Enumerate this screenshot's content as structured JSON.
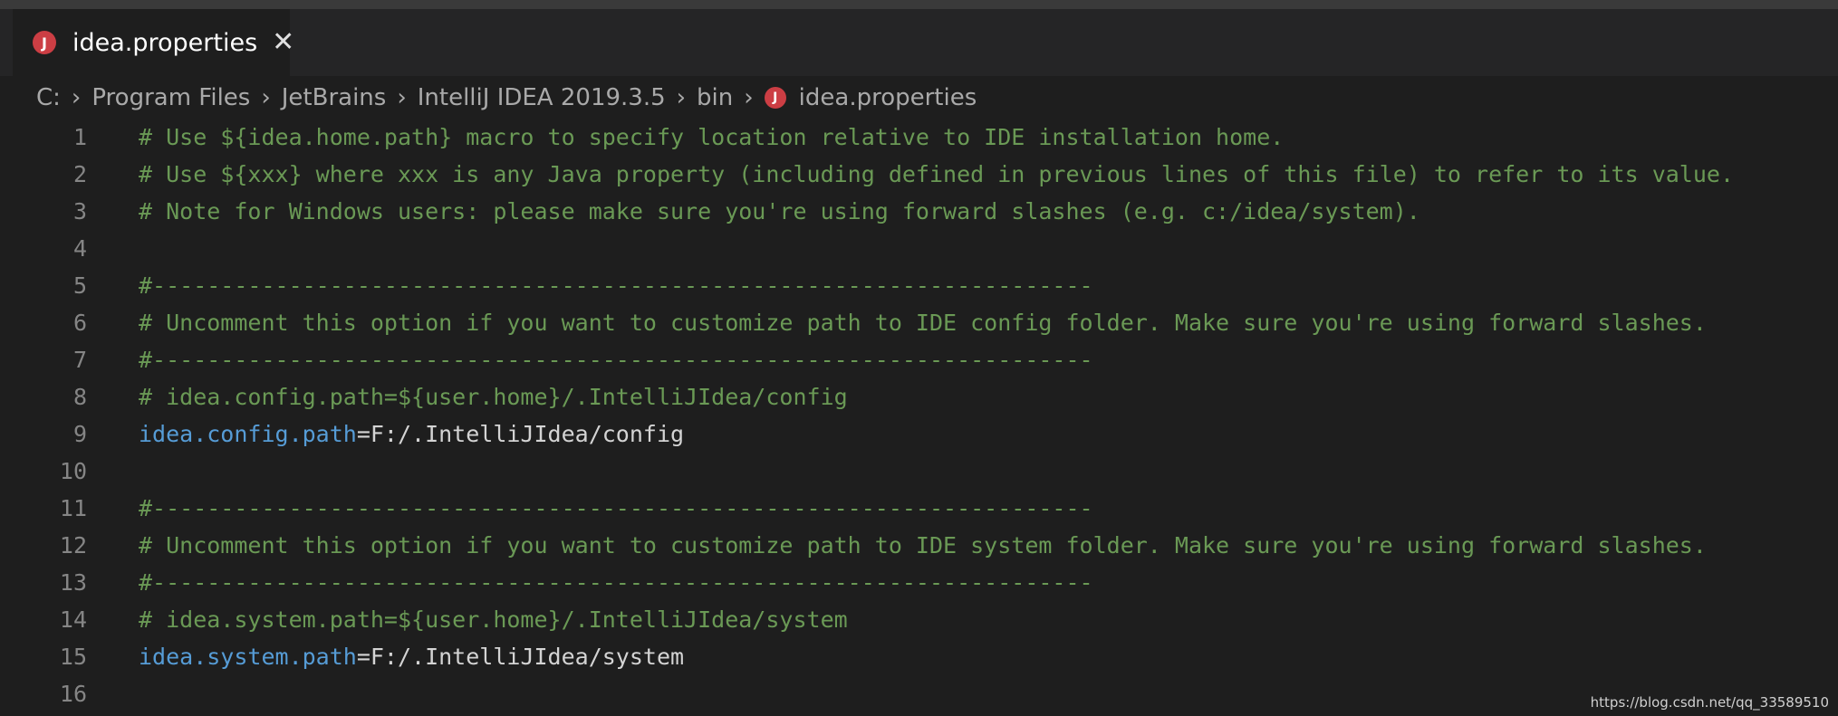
{
  "tab": {
    "icon": "J",
    "label": "idea.properties",
    "close": "✕"
  },
  "breadcrumb": {
    "items": [
      "C:",
      "Program Files",
      "JetBrains",
      "IntelliJ IDEA 2019.3.5",
      "bin"
    ],
    "file_icon": "J",
    "file": "idea.properties",
    "separator": "›"
  },
  "lines": [
    {
      "num": "1",
      "comment": "# Use ${idea.home.path} macro to specify location relative to IDE installation home."
    },
    {
      "num": "2",
      "comment": "# Use ${xxx} where xxx is any Java property (including defined in previous lines of this file) to refer to its value."
    },
    {
      "num": "3",
      "comment": "# Note for Windows users: please make sure you're using forward slashes (e.g. c:/idea/system)."
    },
    {
      "num": "4",
      "comment": ""
    },
    {
      "num": "5",
      "comment": "#---------------------------------------------------------------------"
    },
    {
      "num": "6",
      "comment": "# Uncomment this option if you want to customize path to IDE config folder. Make sure you're using forward slashes."
    },
    {
      "num": "7",
      "comment": "#---------------------------------------------------------------------"
    },
    {
      "num": "8",
      "comment": "# idea.config.path=${user.home}/.IntelliJIdea/config"
    },
    {
      "num": "9",
      "key": "idea.config.path",
      "value": "=F:/.IntelliJIdea/config"
    },
    {
      "num": "10",
      "comment": ""
    },
    {
      "num": "11",
      "comment": "#---------------------------------------------------------------------"
    },
    {
      "num": "12",
      "comment": "# Uncomment this option if you want to customize path to IDE system folder. Make sure you're using forward slashes."
    },
    {
      "num": "13",
      "comment": "#---------------------------------------------------------------------"
    },
    {
      "num": "14",
      "comment": "# idea.system.path=${user.home}/.IntelliJIdea/system"
    },
    {
      "num": "15",
      "key": "idea.system.path",
      "value": "=F:/.IntelliJIdea/system"
    },
    {
      "num": "16",
      "comment": ""
    }
  ],
  "watermark": "https://blog.csdn.net/qq_33589510",
  "colors": {
    "background": "#1e1e1e",
    "comment": "#6a9955",
    "key": "#569cd6",
    "value": "#d4d4d4",
    "line_number": "#858585",
    "file_icon": "#cc3e44"
  }
}
